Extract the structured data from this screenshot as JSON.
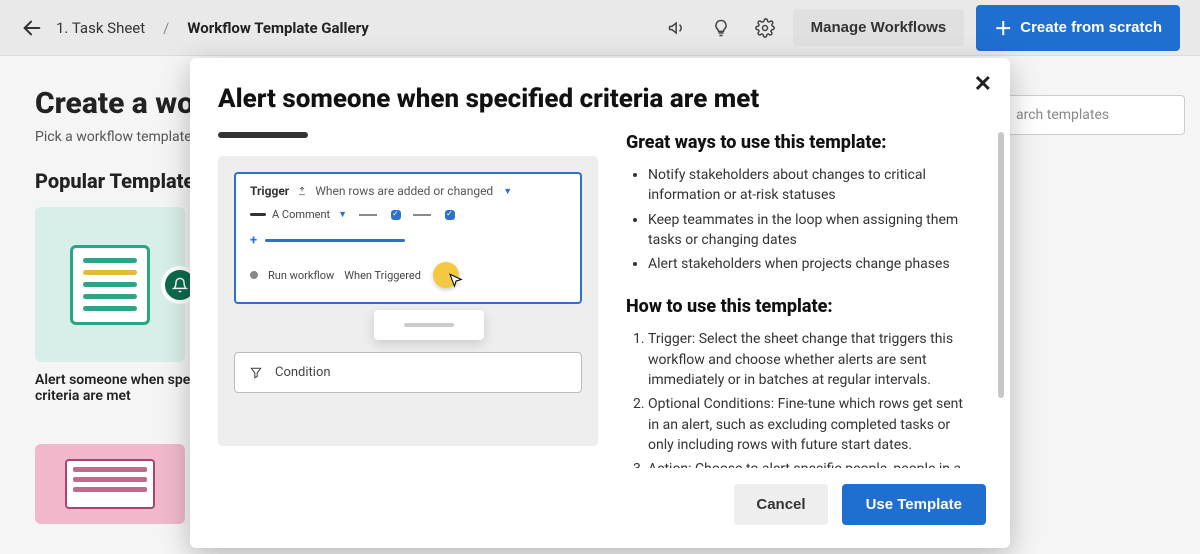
{
  "topbar": {
    "crumb1": "1. Task Sheet",
    "crumb2": "Workflow Template Gallery",
    "manage_label": "Manage Workflows",
    "create_label": "Create from scratch"
  },
  "page": {
    "heading": "Create a workflow",
    "subheading": "Pick a workflow template",
    "section_title": "Popular Templates",
    "card1_label": "Alert someone when specified criteria are met",
    "search_placeholder": "arch templates"
  },
  "modal": {
    "title": "Alert someone when specified criteria are met",
    "preview": {
      "trigger_label": "Trigger",
      "trigger_desc": "When rows are added or changed",
      "comment_label": "A Comment",
      "run_label": "Run workflow",
      "when_label": "When Triggered",
      "condition_label": "Condition"
    },
    "great_heading": "Great ways to use this template:",
    "great_items": [
      "Notify stakeholders about changes to critical information or at-risk statuses",
      "Keep teammates in the loop when assigning them tasks or changing dates",
      "Alert stakeholders when projects change phases"
    ],
    "how_heading": "How to use this template:",
    "how_items": [
      "Trigger: Select the sheet change that triggers this workflow and choose whether alerts are sent immediately or in batches at regular intervals.",
      "Optional Conditions: Fine-tune which rows get sent in an alert, such as excluding completed tasks or only including rows with future start dates.",
      "Action: Choose to alert specific people, people in a"
    ],
    "cancel_label": "Cancel",
    "use_label": "Use Template"
  }
}
